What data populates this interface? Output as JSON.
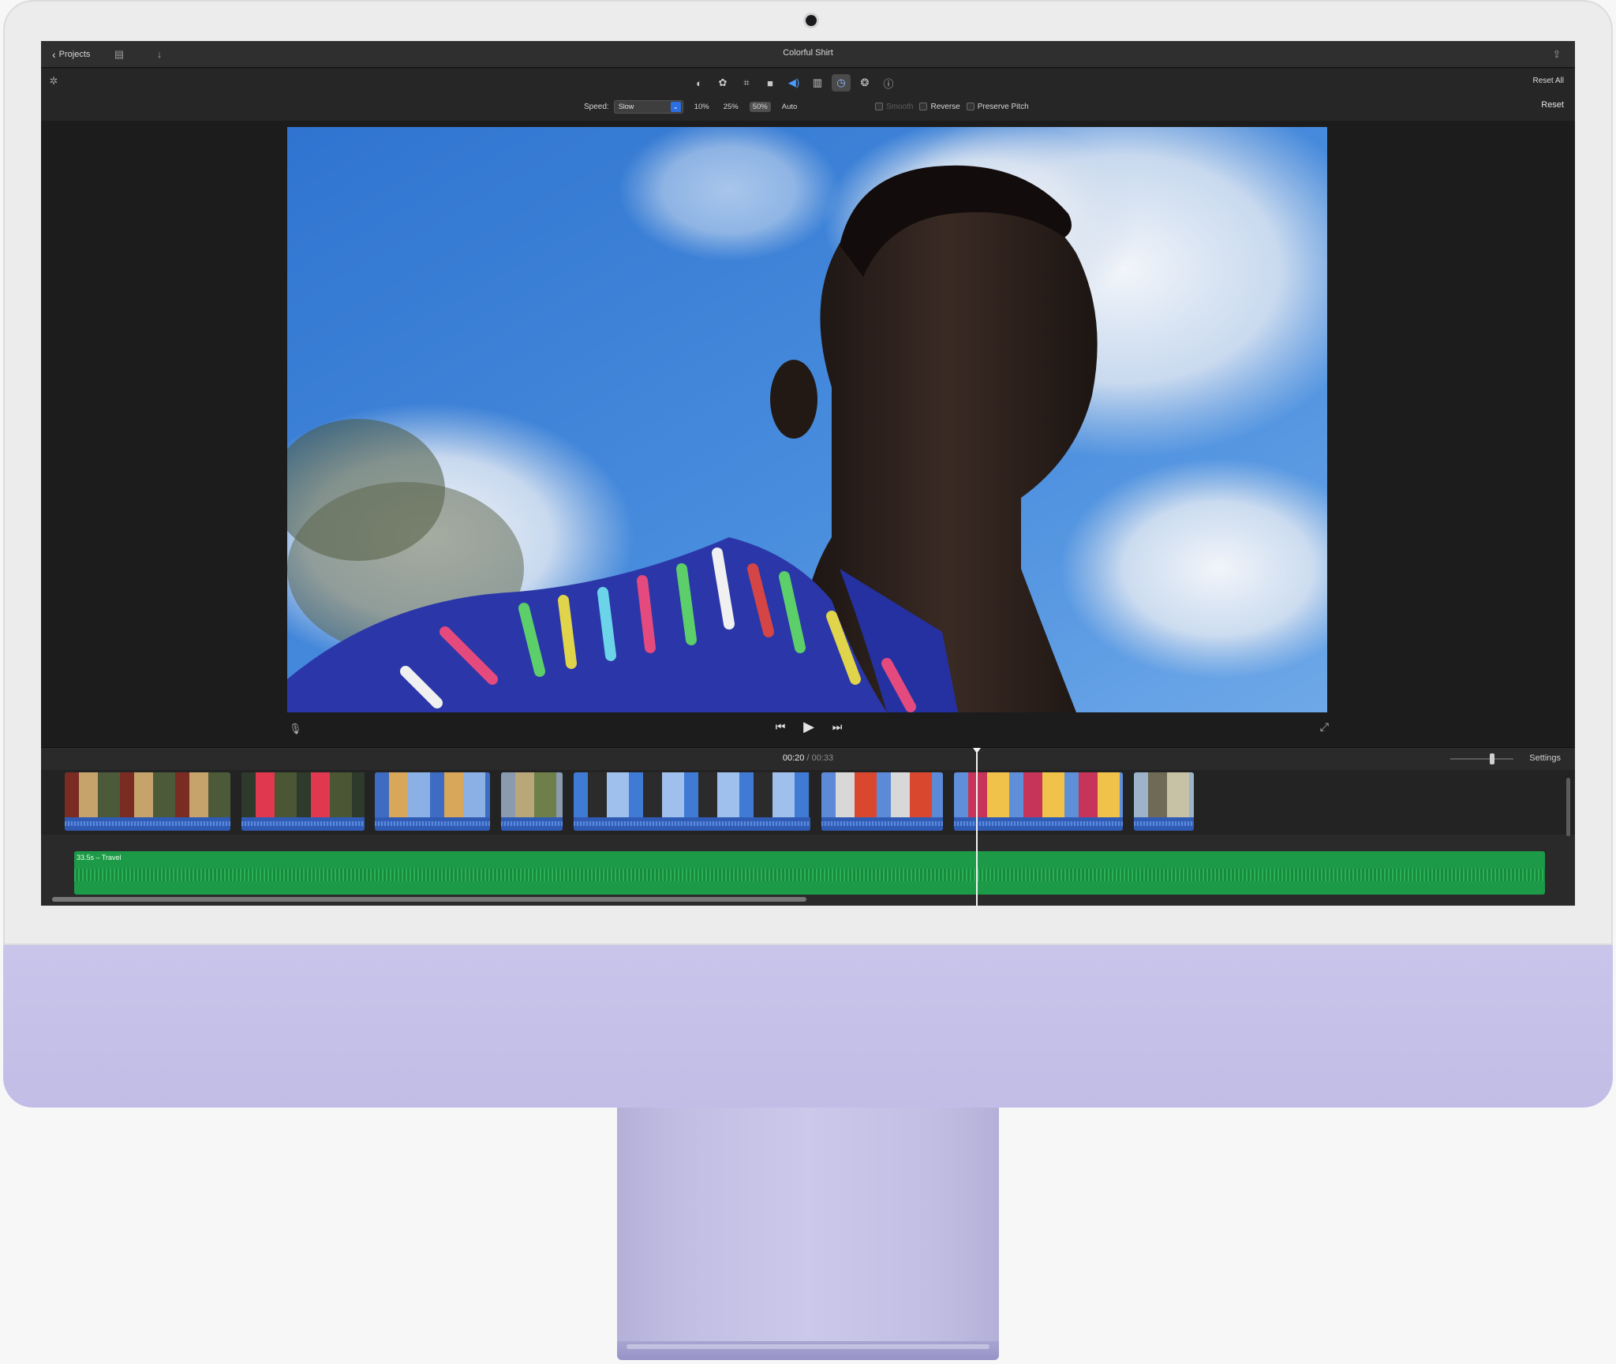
{
  "titlebar": {
    "back_label": "Projects",
    "title": "Colorful Shirt",
    "icons": [
      "chevron-left-icon",
      "film-strip-icon",
      "download-arrow-icon",
      "share-icon"
    ]
  },
  "toolbar": {
    "tools": [
      {
        "name": "color-balance-icon",
        "glyph": "◐",
        "active": false
      },
      {
        "name": "color-correction-icon",
        "glyph": "✿",
        "active": false
      },
      {
        "name": "crop-icon",
        "glyph": "⌗",
        "active": false
      },
      {
        "name": "stabilization-icon",
        "glyph": "■",
        "active": false
      },
      {
        "name": "volume-icon",
        "glyph": "◀)",
        "active": false,
        "blue": true
      },
      {
        "name": "equalizer-icon",
        "glyph": "▥",
        "active": false
      },
      {
        "name": "speed-icon",
        "glyph": "◷",
        "active": true
      },
      {
        "name": "clip-filter-icon",
        "glyph": "❂",
        "active": false
      },
      {
        "name": "info-icon",
        "glyph": "ⓘ",
        "active": false
      }
    ],
    "reset_all": "Reset All",
    "speed_label": "Speed:",
    "speed_value": "Slow",
    "presets": [
      "10%",
      "25%",
      "50%",
      "Auto"
    ],
    "selected_preset": "50%",
    "smooth": "Smooth",
    "reverse": "Reverse",
    "preserve_pitch": "Preserve Pitch",
    "reset": "Reset"
  },
  "transport": {
    "prev": "⏮",
    "play": "▶",
    "next": "⏭"
  },
  "timeline": {
    "current_time": "00:20",
    "separator": "/",
    "total_time": "00:33",
    "settings": "Settings",
    "audio_label": "33.5s – Travel",
    "clips": [
      {
        "name": "clip-woman-window",
        "colors": [
          "#7a2b22",
          "#c7a36c",
          "#4c5a3a"
        ]
      },
      {
        "name": "clip-red-leaf",
        "colors": [
          "#2e3a2b",
          "#e0384f",
          "#4a5634"
        ]
      },
      {
        "name": "clip-woman-sky",
        "colors": [
          "#3d6cc2",
          "#d9a75a",
          "#8ab0e6"
        ]
      },
      {
        "name": "clip-landscape",
        "colors": [
          "#8a9bb0",
          "#b9a77a",
          "#6f7f4a"
        ]
      },
      {
        "name": "clip-man-sky",
        "colors": [
          "#3f7ad4",
          "#2b2b2b",
          "#9fc0ec"
        ]
      },
      {
        "name": "clip-friends-jackets",
        "colors": [
          "#5d8ad6",
          "#d8d8d8",
          "#d9482e"
        ]
      },
      {
        "name": "clip-group-selfie",
        "colors": [
          "#5f8fd8",
          "#c6345a",
          "#f0c24a"
        ]
      },
      {
        "name": "clip-coast",
        "colors": [
          "#9cb3c9",
          "#6e6a56",
          "#c7c1a6"
        ]
      }
    ]
  }
}
